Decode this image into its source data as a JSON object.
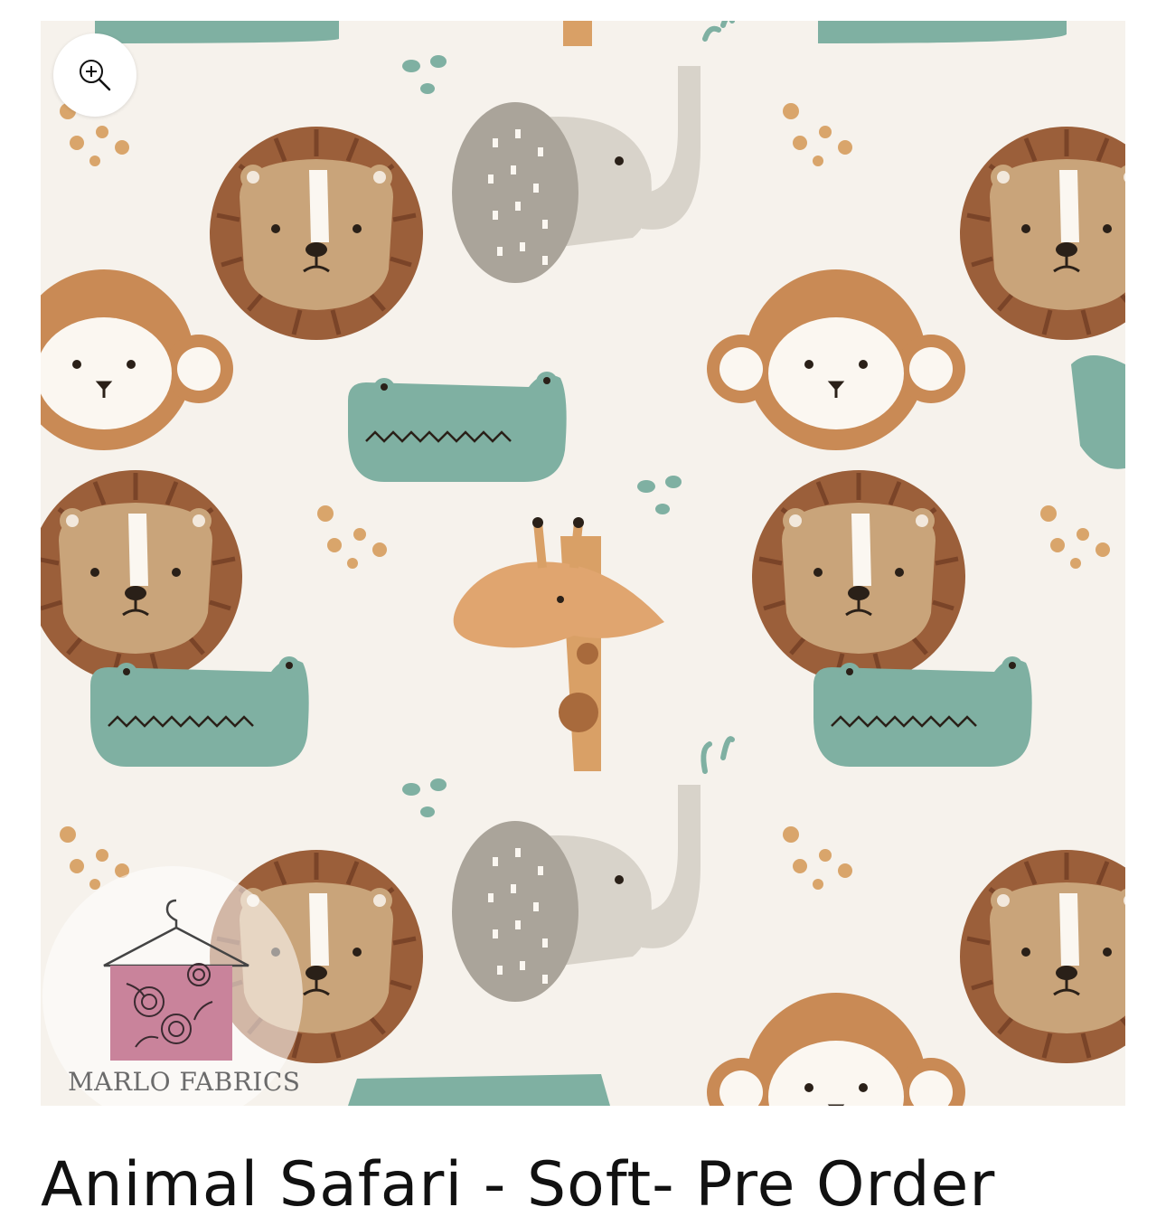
{
  "product": {
    "title": "Animal Safari - Soft- Pre Order",
    "watermark_brand": "MARLO FABRICS"
  },
  "image": {
    "background_color": "#f6f2ec",
    "zoom_icon": "zoom-in-icon"
  },
  "colors": {
    "lion_mane": "#9b5f3a",
    "lion_face": "#c9a47a",
    "crocodile": "#7fb0a2",
    "monkey": "#c98a55",
    "giraffe": "#d9a066",
    "elephant": "#b8b2a8",
    "brand_pink": "#c9839b"
  }
}
